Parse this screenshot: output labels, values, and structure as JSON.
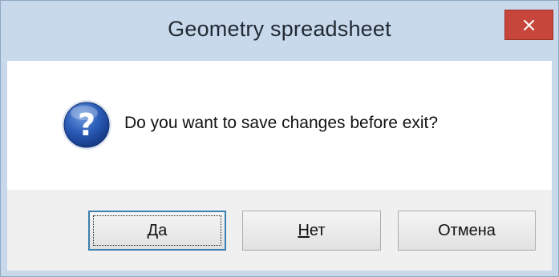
{
  "window": {
    "title": "Geometry spreadsheet",
    "close_symbol": "×"
  },
  "dialog": {
    "icon": "question-icon",
    "message": "Do you want to save changes before exit?"
  },
  "buttons": [
    {
      "accel": "Д",
      "rest": "а",
      "default": true
    },
    {
      "accel": "Н",
      "rest": "ет",
      "default": false
    },
    {
      "accel": "",
      "rest": "Отмена",
      "default": false
    }
  ],
  "colors": {
    "titlebar": "#c8d9ec",
    "close_button": "#c7463b",
    "icon_blue": "#1f4fa6",
    "footer": "#f0f0f0"
  }
}
